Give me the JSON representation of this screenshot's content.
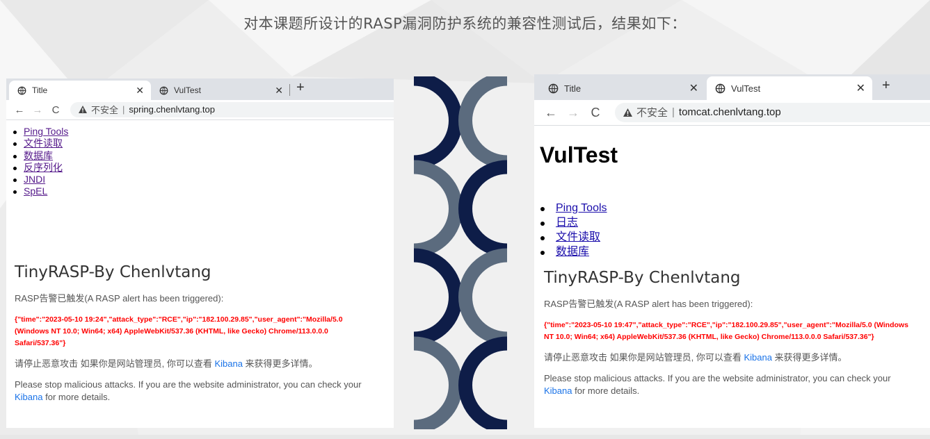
{
  "slide": {
    "title": "对本课题所设计的RASP漏洞防护系统的兼容性测试后，结果如下："
  },
  "colors": {
    "deco_dark": "#0e1d48",
    "deco_gray": "#5b6b7e",
    "alert_red": "#ff0000",
    "link_blue": "#1a73e8"
  },
  "left_browser": {
    "tabs": [
      {
        "label": "Title",
        "icon": "globe-icon",
        "active": true
      },
      {
        "label": "VulTest",
        "icon": "globe-icon",
        "active": false
      }
    ],
    "new_tab": "+",
    "close_glyph": "✕",
    "nav": {
      "back": "←",
      "forward": "→",
      "reload": "C"
    },
    "address": {
      "warning": "不安全",
      "separator": "|",
      "url": "spring.chenlvtang.top"
    },
    "links": [
      "Ping Tools",
      "文件读取",
      "数据库",
      "反序列化",
      "JNDI",
      "SpEL"
    ],
    "rasp": {
      "title": "TinyRASP-By Chenlvtang",
      "subtitle": "RASP告警已触发(A RASP alert has been triggered):",
      "json": "{\"time\":\"2023-05-10 19:24\",\"attack_type\":\"RCE\",\"ip\":\"182.100.29.85\",\"user_agent\":\"Mozilla/5.0 (Windows NT 10.0; Win64; x64) AppleWebKit/537.36 (KHTML, like Gecko) Chrome/113.0.0.0 Safari/537.36\"}",
      "cn_before": "请停止恶意攻击 如果你是网站管理员, 你可以查看 ",
      "cn_link": "Kibana",
      "cn_after": " 来获得更多详情。",
      "en_before": "Please stop malicious attacks. If you are the website administrator, you can check your ",
      "en_link": "Kibana",
      "en_after": " for more details."
    }
  },
  "right_browser": {
    "tabs": [
      {
        "label": "Title",
        "icon": "globe-icon",
        "active": false
      },
      {
        "label": "VulTest",
        "icon": "globe-icon",
        "active": true
      }
    ],
    "new_tab": "+",
    "close_glyph": "✕",
    "nav": {
      "back": "←",
      "forward": "→",
      "reload": "C"
    },
    "address": {
      "warning": "不安全",
      "separator": "|",
      "url": "tomcat.chenlvtang.top"
    },
    "heading": "VulTest",
    "links": [
      "Ping Tools",
      "日志",
      "文件读取",
      "数据库"
    ],
    "rasp": {
      "title": "TinyRASP-By Chenlvtang",
      "subtitle": "RASP告警已触发(A RASP alert has been triggered):",
      "json": "{\"time\":\"2023-05-10 19:47\",\"attack_type\":\"RCE\",\"ip\":\"182.100.29.85\",\"user_agent\":\"Mozilla/5.0 (Windows NT 10.0; Win64; x64) AppleWebKit/537.36 (KHTML, like Gecko) Chrome/113.0.0.0 Safari/537.36\"}",
      "cn_before": "请停止恶意攻击 如果你是网站管理员, 你可以查看 ",
      "cn_link": "Kibana",
      "cn_after": " 来获得更多详情。",
      "en_before": "Please stop malicious attacks. If you are the website administrator, you can check your ",
      "en_link": "Kibana",
      "en_after": " for more details."
    }
  }
}
